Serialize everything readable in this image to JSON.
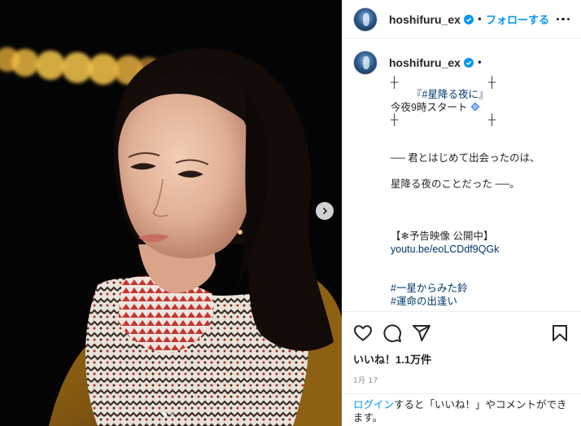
{
  "post": {
    "username": "hoshifuru_ex",
    "follow_label": "フォローする",
    "separator": "•",
    "photo_alt": "暗い背景に白い模様のマフラーとマスタード色のコートを着た女性の写真"
  },
  "caption": {
    "username": "hoshifuru_ex",
    "separator": "•",
    "cross": "┼",
    "title": "『#星降る夜に』",
    "time_line": "今夜9時スタート",
    "line1": "── 君とはじめて出会ったのは、",
    "line2": "星降る夜のことだった ──。",
    "trailer_label": "【❄予告映像 公開中】",
    "trailer_link": "youtu.be/eoLCDdf9QGk",
    "hashtag1": "#一星からみた鈴",
    "hashtag2": "#運命の出逢い",
    "trailing": "❄"
  },
  "actions": {
    "likes": "いいね！1.1万件",
    "date": "1月 17"
  },
  "login": {
    "link": "ログイン",
    "text": "すると「いいね！」やコメントができます。"
  },
  "carousel": {
    "count": 2,
    "active_index": 0
  },
  "colors": {
    "link_blue": "#0095f6",
    "hashtag_blue": "#00376b",
    "text": "#262626",
    "muted": "#8e8e8e",
    "border": "#efefef"
  },
  "icons": {
    "like": "heart-icon",
    "comment": "comment-bubble-icon",
    "share": "paper-plane-icon",
    "save": "bookmark-icon",
    "more": "more-dots-icon",
    "verified": "verified-badge-icon",
    "next": "chevron-right-icon",
    "emoji": "blue-diamond-icon"
  }
}
